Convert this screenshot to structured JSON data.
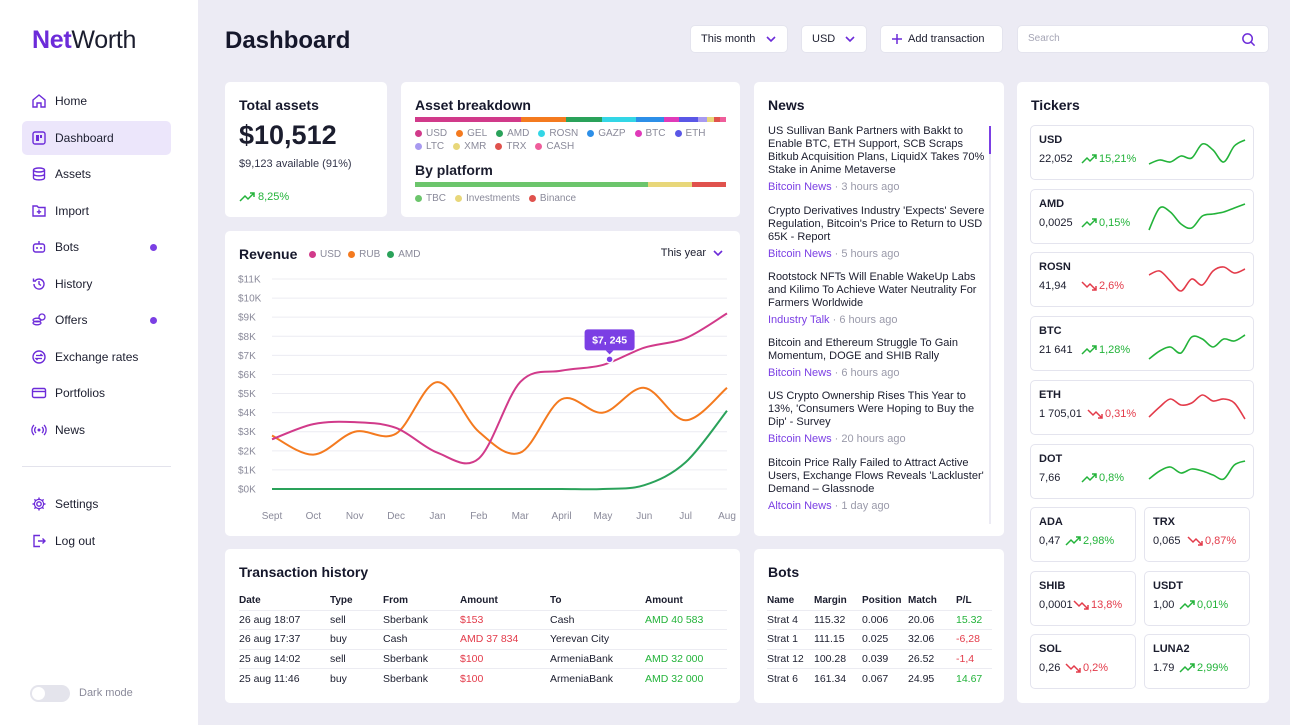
{
  "brand": {
    "part1": "Net",
    "part2": "Worth"
  },
  "sidebar": {
    "items": [
      {
        "label": "Home",
        "icon": "home-icon"
      },
      {
        "label": "Dashboard",
        "icon": "dashboard-icon",
        "active": true
      },
      {
        "label": "Assets",
        "icon": "database-icon"
      },
      {
        "label": "Import",
        "icon": "import-icon"
      },
      {
        "label": "Bots",
        "icon": "bot-icon",
        "badge": true
      },
      {
        "label": "History",
        "icon": "history-icon"
      },
      {
        "label": "Offers",
        "icon": "coins-icon",
        "badge": true
      },
      {
        "label": "Exchange rates",
        "icon": "exchange-icon"
      },
      {
        "label": "Portfolios",
        "icon": "card-icon"
      },
      {
        "label": "News",
        "icon": "broadcast-icon"
      }
    ],
    "bottom": [
      {
        "label": "Settings",
        "icon": "gear-icon"
      },
      {
        "label": "Log out",
        "icon": "logout-icon"
      }
    ],
    "dark_mode_label": "Dark mode"
  },
  "header": {
    "title": "Dashboard",
    "period": "This month",
    "currency": "USD",
    "add_transaction": "Add transaction",
    "search_placeholder": "Search"
  },
  "total_assets": {
    "title": "Total assets",
    "value": "$10,512",
    "available": "$9,123 available (91%)",
    "change": "8,25%"
  },
  "asset_breakdown": {
    "title": "Asset breakdown",
    "segments": [
      {
        "name": "USD",
        "color": "#d13a8a",
        "share": 0.34
      },
      {
        "name": "GEL",
        "color": "#f47a1f",
        "share": 0.145
      },
      {
        "name": "AMD",
        "color": "#2aa25a",
        "share": 0.115
      },
      {
        "name": "ROSN",
        "color": "#33d6e6",
        "share": 0.11
      },
      {
        "name": "GAZP",
        "color": "#2d8fe8",
        "share": 0.09
      },
      {
        "name": "BTC",
        "color": "#e03ab9",
        "share": 0.05
      },
      {
        "name": "ETH",
        "color": "#5a57e6",
        "share": 0.06
      },
      {
        "name": "LTC",
        "color": "#a89af0",
        "share": 0.03
      },
      {
        "name": "XMR",
        "color": "#e8d77a",
        "share": 0.02
      },
      {
        "name": "TRX",
        "color": "#e0524d",
        "share": 0.02
      },
      {
        "name": "CASH",
        "color": "#ef5d9b",
        "share": 0.02
      }
    ],
    "platform_title": "By platform",
    "platforms": [
      {
        "name": "TBC",
        "color": "#6cc56c",
        "share": 0.75
      },
      {
        "name": "Investments",
        "color": "#e8d77a",
        "share": 0.14
      },
      {
        "name": "Binance",
        "color": "#e0524d",
        "share": 0.11
      }
    ]
  },
  "revenue": {
    "title": "Revenue",
    "range": "This year",
    "tooltip": "$7, 245"
  },
  "chart_data": {
    "type": "line",
    "title": "Revenue",
    "categories": [
      "Sept",
      "Oct",
      "Nov",
      "Dec",
      "Jan",
      "Feb",
      "Mar",
      "April",
      "May",
      "Jun",
      "Jul",
      "Aug"
    ],
    "y_ticks": [
      "$0K",
      "$1K",
      "$2K",
      "$3K",
      "$4K",
      "$5K",
      "$6K",
      "$7K",
      "$8K",
      "$9K",
      "$10K",
      "$11K"
    ],
    "ylim": [
      0,
      11000
    ],
    "grid": true,
    "legend": "top",
    "series": [
      {
        "name": "USD",
        "color": "#d13a8a",
        "values": [
          2600,
          3400,
          3500,
          3200,
          1900,
          1600,
          5600,
          6200,
          6500,
          7400,
          7900,
          9200
        ]
      },
      {
        "name": "RUB",
        "color": "#f47a1f",
        "values": [
          2800,
          1800,
          3000,
          2900,
          5600,
          3000,
          1900,
          4700,
          4000,
          5300,
          3600,
          5300
        ]
      },
      {
        "name": "AMD",
        "color": "#2aa25a",
        "values": [
          0,
          0,
          0,
          0,
          0,
          0,
          0,
          0,
          0,
          200,
          1400,
          4100
        ]
      }
    ]
  },
  "news": {
    "title": "News",
    "items": [
      {
        "headline": "US Sullivan Bank Partners with Bakkt to Enable BTC, ETH Support, SCB Scraps Bitkub Acquisition Plans, LiquidX Takes 70% Stake in Anime Metaverse",
        "source": "Bitcoin News",
        "time": "3 hours ago"
      },
      {
        "headline": "Crypto Derivatives Industry 'Expects' Severe Regulation, Bitcoin's Price to Return to USD 65K - Report",
        "source": "Bitcoin News",
        "time": "5 hours ago"
      },
      {
        "headline": "Rootstock NFTs Will Enable WakeUp Labs and Kilimo To Achieve Water Neutrality For Farmers Worldwide",
        "source": "Industry Talk",
        "time": "6 hours ago"
      },
      {
        "headline": "Bitcoin and Ethereum Struggle To Gain Momentum, DOGE and SHIB Rally",
        "source": "Bitcoin News",
        "time": "6 hours ago"
      },
      {
        "headline": "US Crypto Ownership Rises This Year to 13%, 'Consumers Were Hoping to Buy the Dip' - Survey",
        "source": "Bitcoin News",
        "time": "20 hours ago"
      },
      {
        "headline": "Bitcoin Price Rally Failed to Attract Active Users, Exchange Flows Reveals 'Lackluster' Demand – Glassnode",
        "source": "Altcoin News",
        "time": "1 day ago"
      }
    ]
  },
  "tickers": {
    "title": "Tickers",
    "wide": [
      {
        "symbol": "USD",
        "price": "22,052",
        "change": "15,21%",
        "up": true,
        "spark": [
          10,
          14,
          12,
          18,
          16,
          30,
          24,
          12,
          28,
          34
        ]
      },
      {
        "symbol": "AMD",
        "price": "0,0025",
        "change": "0,15%",
        "up": true,
        "spark": [
          8,
          30,
          26,
          14,
          10,
          22,
          24,
          26,
          30,
          34
        ]
      },
      {
        "symbol": "ROSN",
        "price": "41,94",
        "change": "2,6%",
        "up": false,
        "spark": [
          26,
          30,
          20,
          10,
          22,
          16,
          30,
          34,
          28,
          32
        ]
      },
      {
        "symbol": "BTC",
        "price": "21 641",
        "change": "1,28%",
        "up": true,
        "spark": [
          6,
          14,
          18,
          12,
          28,
          26,
          18,
          26,
          24,
          30
        ]
      },
      {
        "symbol": "ETH",
        "price": "1 705,01",
        "change": "0,31%",
        "up": false,
        "spark": [
          12,
          22,
          30,
          24,
          26,
          34,
          28,
          30,
          26,
          10
        ]
      },
      {
        "symbol": "DOT",
        "price": "7,66",
        "change": "0,8%",
        "up": true,
        "spark": [
          14,
          22,
          26,
          20,
          24,
          22,
          18,
          14,
          28,
          32
        ]
      }
    ],
    "small": [
      {
        "symbol": "ADA",
        "price": "0,47",
        "change": "2,98%",
        "up": true
      },
      {
        "symbol": "TRX",
        "price": "0,065",
        "change": "0,87%",
        "up": false
      },
      {
        "symbol": "SHIB",
        "price": "0,0001",
        "change": "13,8%",
        "up": false
      },
      {
        "symbol": "USDT",
        "price": "1,00",
        "change": "0,01%",
        "up": true
      },
      {
        "symbol": "SOL",
        "price": "0,26",
        "change": "0,2%",
        "up": false
      },
      {
        "symbol": "LUNA2",
        "price": "1.79",
        "change": "2,99%",
        "up": true
      }
    ]
  },
  "transactions": {
    "title": "Transaction history",
    "columns": [
      "Date",
      "Type",
      "From",
      "Amount",
      "To",
      "Amount"
    ],
    "rows": [
      {
        "date": "26 aug 18:07",
        "type": "sell",
        "from": "Sberbank",
        "amount_out": "$153",
        "to": "Cash",
        "amount_in": "AMD 40 583"
      },
      {
        "date": "26 aug 17:37",
        "type": "buy",
        "from": "Cash",
        "amount_out": "AMD 37 834",
        "to": "Yerevan City",
        "amount_in": ""
      },
      {
        "date": "25 aug 14:02",
        "type": "sell",
        "from": "Sberbank",
        "amount_out": "$100",
        "to": "ArmeniaBank",
        "amount_in": "AMD 32 000"
      },
      {
        "date": "25 aug 11:46",
        "type": "buy",
        "from": "Sberbank",
        "amount_out": "$100",
        "to": "ArmeniaBank",
        "amount_in": "AMD 32 000"
      }
    ]
  },
  "bots": {
    "title": "Bots",
    "columns": [
      "Name",
      "Margin",
      "Position",
      "Match",
      "P/L"
    ],
    "rows": [
      {
        "name": "Strat 4",
        "margin": "115.32",
        "position": "0.006",
        "match": "20.06",
        "pl": "15.32",
        "up": true
      },
      {
        "name": "Strat 1",
        "margin": "111.15",
        "position": "0.025",
        "match": "32.06",
        "pl": "-6,28",
        "up": false
      },
      {
        "name": "Strat 12",
        "margin": "100.28",
        "position": "0.039",
        "match": "26.52",
        "pl": "-1,4",
        "up": false
      },
      {
        "name": "Strat 6",
        "margin": "161.34",
        "position": "0.067",
        "match": "24.95",
        "pl": "14.67",
        "up": true
      }
    ]
  },
  "colors": {
    "accent": "#7b3fe4",
    "up": "#23b33a",
    "down": "#e33b4a"
  }
}
